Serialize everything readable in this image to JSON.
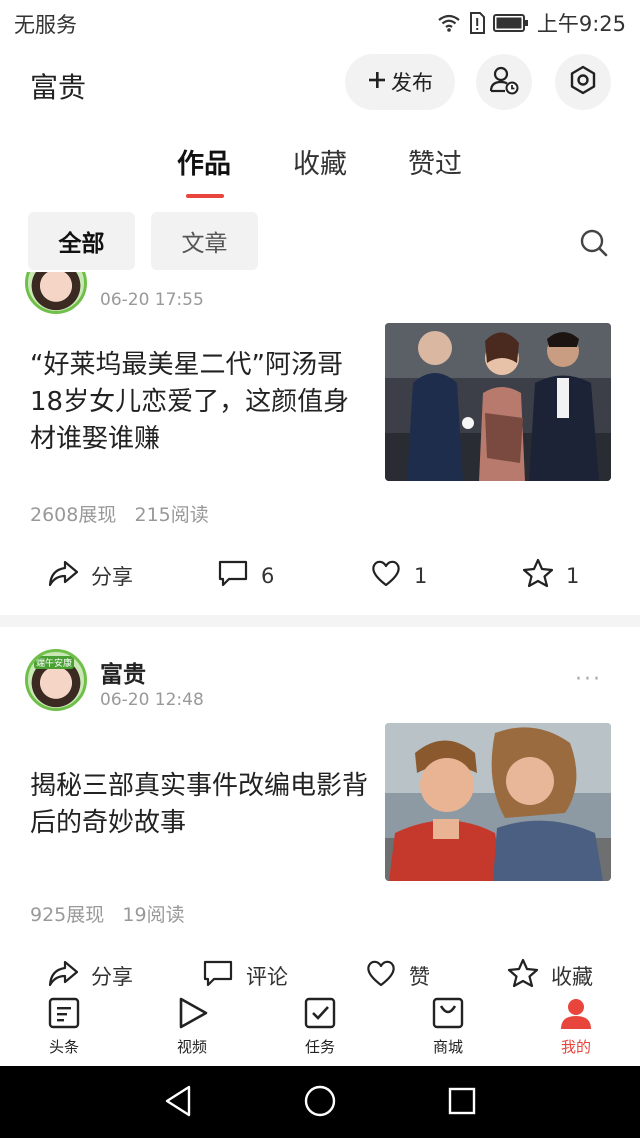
{
  "status_bar": {
    "carrier": "无服务",
    "time": "上午9:25"
  },
  "header": {
    "username": "富贵",
    "publish_label": "发布"
  },
  "tabs": [
    {
      "label": "作品",
      "active": true
    },
    {
      "label": "收藏",
      "active": false
    },
    {
      "label": "赞过",
      "active": false
    }
  ],
  "filters": [
    {
      "label": "全部",
      "active": true
    },
    {
      "label": "文章",
      "active": false
    }
  ],
  "posts": [
    {
      "author": "",
      "time": "06-20 17:55",
      "title": "“好莱坞最美星二代”阿汤哥18岁女儿恋爱了，这颜值身材谁娶谁赚",
      "stats": {
        "impressions": "2608展现",
        "reads": "215阅读"
      },
      "actions": {
        "share": "分享",
        "comments": "6",
        "likes": "1",
        "favorites": "1"
      }
    },
    {
      "author": "富贵",
      "avatar_badge": "端午安康",
      "time": "06-20 12:48",
      "more": "···",
      "title": "揭秘三部真实事件改编电影背后的奇妙故事",
      "stats": {
        "impressions": "925展现",
        "reads": "19阅读"
      },
      "actions": {
        "share": "分享",
        "comment": "评论",
        "like": "赞",
        "favorite": "收藏"
      }
    }
  ],
  "bottom_nav": [
    {
      "label": "头条",
      "icon": "news-icon",
      "active": false
    },
    {
      "label": "视频",
      "icon": "play-icon",
      "active": false
    },
    {
      "label": "任务",
      "icon": "task-icon",
      "active": false
    },
    {
      "label": "商城",
      "icon": "shop-icon",
      "active": false
    },
    {
      "label": "我的",
      "icon": "profile-icon",
      "active": true
    }
  ],
  "colors": {
    "accent": "#e8453c",
    "chip_bg": "#f2f2f2",
    "muted_text": "#999999"
  }
}
